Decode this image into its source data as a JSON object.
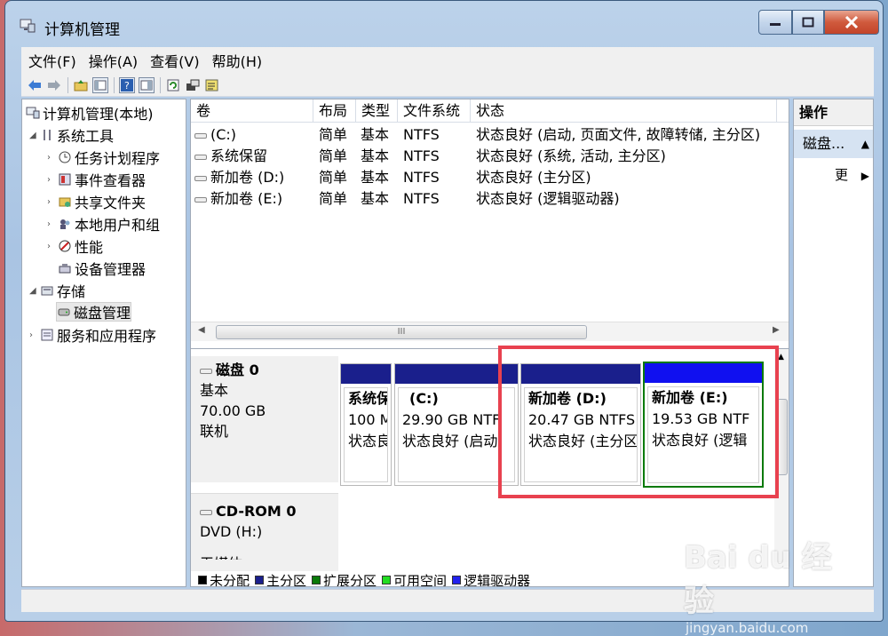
{
  "window": {
    "title": "计算机管理"
  },
  "menu": [
    "文件(F)",
    "操作(A)",
    "查看(V)",
    "帮助(H)"
  ],
  "tree": [
    {
      "label": "计算机管理(本地)",
      "icon": "computer-management-icon"
    },
    {
      "label": "系统工具",
      "icon": "tools-icon"
    },
    {
      "label": "任务计划程序",
      "icon": "clock-icon"
    },
    {
      "label": "事件查看器",
      "icon": "event-viewer-icon"
    },
    {
      "label": "共享文件夹",
      "icon": "shared-folder-icon"
    },
    {
      "label": "本地用户和组",
      "icon": "users-icon"
    },
    {
      "label": "性能",
      "icon": "performance-icon"
    },
    {
      "label": "设备管理器",
      "icon": "device-manager-icon"
    },
    {
      "label": "存储",
      "icon": "storage-icon"
    },
    {
      "label": "磁盘管理",
      "icon": "disk-icon"
    },
    {
      "label": "服务和应用程序",
      "icon": "services-icon"
    }
  ],
  "volumes": {
    "headers": [
      "卷",
      "布局",
      "类型",
      "文件系统",
      "状态"
    ],
    "rows": [
      [
        "(C:)",
        "简单",
        "基本",
        "NTFS",
        "状态良好 (启动, 页面文件, 故障转储, 主分区)"
      ],
      [
        "系统保留",
        "简单",
        "基本",
        "NTFS",
        "状态良好 (系统, 活动, 主分区)"
      ],
      [
        "新加卷 (D:)",
        "简单",
        "基本",
        "NTFS",
        "状态良好 (主分区)"
      ],
      [
        "新加卷 (E:)",
        "简单",
        "基本",
        "NTFS",
        "状态良好 (逻辑驱动器)"
      ]
    ],
    "scroll_glyph": "III"
  },
  "disk0": {
    "name": "磁盘 0",
    "type": "基本",
    "size": "70.00 GB",
    "status": "联机",
    "partitions": [
      {
        "name": "系统保",
        "size": "100 M",
        "status": "状态良"
      },
      {
        "name": "(C:)",
        "size": "29.90 GB NTF",
        "status": "状态良好 (启动"
      },
      {
        "name": "新加卷 (D:)",
        "size": "20.47 GB NTFS",
        "status": "状态良好 (主分区"
      },
      {
        "name": "新加卷 (E:)",
        "size": "19.53 GB NTF",
        "status": "状态良好 (逻辑"
      }
    ]
  },
  "cdrom": {
    "name": "CD-ROM 0",
    "drive": "DVD (H:)",
    "partial": "无媒体"
  },
  "legend": [
    {
      "label": "未分配",
      "color": "#000000"
    },
    {
      "label": "主分区",
      "color": "#1a1f8c"
    },
    {
      "label": "扩展分区",
      "color": "#0a7a0a"
    },
    {
      "label": "可用空间",
      "color": "#22dd22"
    },
    {
      "label": "逻辑驱动器",
      "color": "#2222ee"
    }
  ],
  "ops": {
    "title": "操作",
    "section": "磁盘...",
    "more": "更"
  },
  "watermark": {
    "main": "Bai du 经验",
    "sub": "jingyan.baidu.com"
  },
  "colors": {
    "primary_partition": "#1a1f8c",
    "logical_partition": "#1010f0",
    "selection_green": "#0a7a0a",
    "highlight_red": "#e8414f"
  }
}
